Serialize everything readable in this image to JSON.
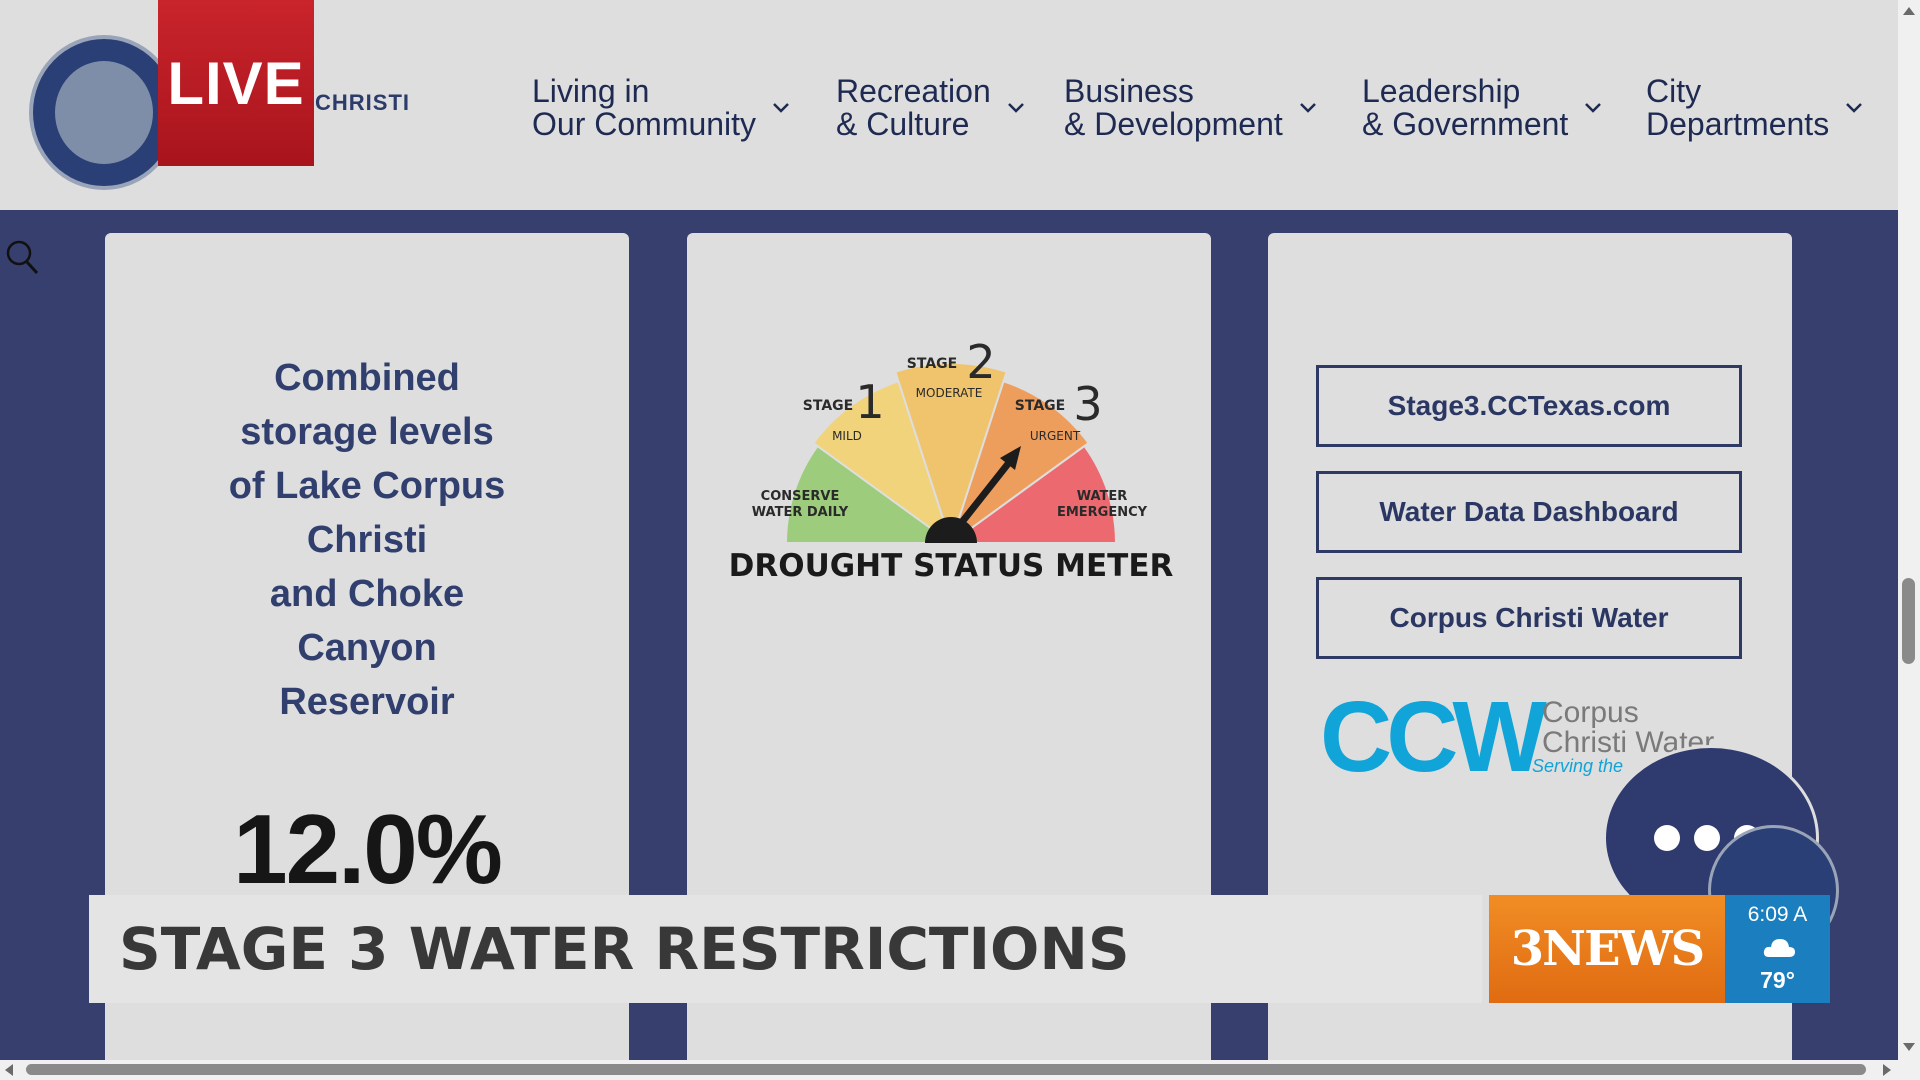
{
  "header": {
    "live_label": "LIVE",
    "brand_text": "CHRISTI",
    "nav": [
      {
        "line1": "Living in",
        "line2": "Our Community"
      },
      {
        "line1": "Recreation",
        "line2": "& Culture"
      },
      {
        "line1": "Business",
        "line2": "& Development"
      },
      {
        "line1": "Leadership",
        "line2": "& Government"
      },
      {
        "line1": "City",
        "line2": "Departments"
      }
    ]
  },
  "storage_card": {
    "lines": [
      "Combined",
      "storage levels",
      "of Lake Corpus",
      "Christi",
      "and Choke",
      "Canyon",
      "Reservoir"
    ],
    "percent": "12.0%"
  },
  "gauge": {
    "title": "DROUGHT STATUS METER",
    "segments": [
      {
        "stage": "",
        "num": "",
        "label1": "CONSERVE",
        "label2": "WATER DAILY",
        "color": "#9ccc7c"
      },
      {
        "stage": "STAGE",
        "num": "1",
        "label1": "MILD",
        "label2": "",
        "color": "#f0d37a"
      },
      {
        "stage": "STAGE",
        "num": "2",
        "label1": "MODERATE",
        "label2": "",
        "color": "#efc46c"
      },
      {
        "stage": "STAGE",
        "num": "3",
        "label1": "URGENT",
        "label2": "",
        "color": "#ee9e5c"
      },
      {
        "stage": "",
        "num": "",
        "label1": "WATER",
        "label2": "EMERGENCY",
        "color": "#ec6a6f"
      }
    ],
    "current_stage": 3
  },
  "links": {
    "buttons": [
      "Stage3.CCTexas.com",
      "Water Data Dashboard",
      "Corpus Christi Water"
    ],
    "logo_letters": "CCW",
    "logo_name_line1": "Corpus",
    "logo_name_line2": "Christi Water",
    "logo_tagline": "Serving the"
  },
  "lower_third": {
    "headline": "STAGE 3 WATER RESTRICTIONS",
    "station": "3NEWS",
    "time": "6:09 A",
    "temp": "79°",
    "weather_icon": "cloud-icon"
  },
  "colors": {
    "header_bg": "#dedede",
    "page_bg": "#363f6d",
    "text_navy": "#313f6e",
    "live_red": "#c9242c",
    "news_orange": "#f18d24",
    "weather_blue": "#1b7fbf",
    "ccw_blue": "#10a4d8"
  }
}
